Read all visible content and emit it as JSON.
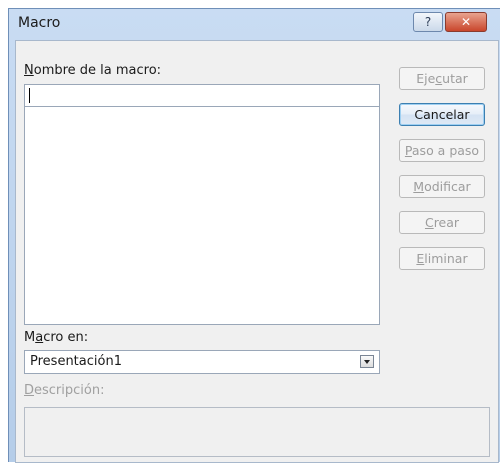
{
  "window": {
    "title": "Macro",
    "help_label": "?",
    "close_label": "✕"
  },
  "macro_name": {
    "label_pre": "",
    "label_key": "N",
    "label_post": "ombre de la macro:",
    "value": ""
  },
  "macro_list": {
    "items": []
  },
  "macro_in": {
    "label_pre": "M",
    "label_key": "a",
    "label_post": "cro en:",
    "selected": "Presentación1"
  },
  "description": {
    "label_pre": "",
    "label_key": "D",
    "label_post": "escripción:",
    "value": ""
  },
  "buttons": {
    "run": {
      "pre": "Eje",
      "key": "c",
      "post": "utar"
    },
    "cancel": {
      "pre": "",
      "key": "",
      "post": "Cancelar"
    },
    "step": {
      "pre": "",
      "key": "P",
      "post": "aso a paso"
    },
    "edit": {
      "pre": "",
      "key": "M",
      "post": "odificar"
    },
    "create": {
      "pre": "",
      "key": "C",
      "post": "rear"
    },
    "delete": {
      "pre": "",
      "key": "E",
      "post": "liminar"
    }
  },
  "colors": {
    "title_bar": "#c9dcf3",
    "dialog_body": "#f0f0f0",
    "default_button_border": "#3c7fb1",
    "close_button": "#c9462c",
    "disabled_text": "#9d9d9d"
  }
}
